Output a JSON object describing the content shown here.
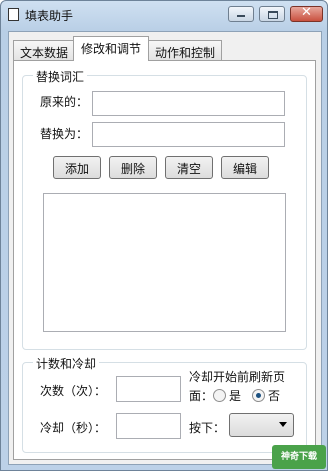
{
  "window": {
    "title": "填表助手"
  },
  "tabs": [
    {
      "label": "文本数据"
    },
    {
      "label": "修改和调节"
    },
    {
      "label": "动作和控制"
    }
  ],
  "replace_group": {
    "title": "替换词汇",
    "original_label": "原来的：",
    "original_value": "",
    "replace_label": "替换为：",
    "replace_value": "",
    "buttons": [
      "添加",
      "删除",
      "清空",
      "编辑"
    ],
    "list_items": []
  },
  "cooldown_group": {
    "title": "计数和冷却",
    "count_label": "次数（次）：",
    "count_value": "",
    "cooldown_label": "冷却（秒）：",
    "cooldown_value": "",
    "refresh_label_line1": "冷却开始前刷新页",
    "refresh_label_line2": "面：",
    "radio_yes": "是",
    "radio_no": "否",
    "selected": "否",
    "press_label": "按下：",
    "press_value": ""
  },
  "watermark": {
    "text": "神奇下载"
  }
}
